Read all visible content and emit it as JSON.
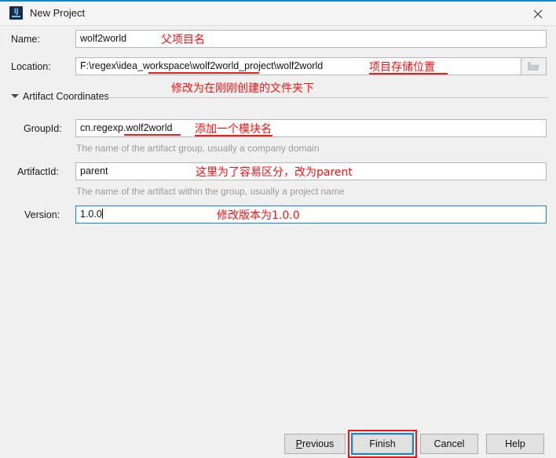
{
  "window": {
    "title": "New Project",
    "app_icon": "intellij-idea-icon",
    "close_icon": "close-icon",
    "accent_color": "#1587c4"
  },
  "form": {
    "name": {
      "label": "Name:",
      "value": "wolf2world"
    },
    "location": {
      "label": "Location:",
      "value": "F:\\regex\\idea_workspace\\wolf2world_project\\wolf2world",
      "browse_icon": "folder-open-icon"
    },
    "section": {
      "title": "Artifact Coordinates",
      "expand_icon": "chevron-down-icon",
      "expanded": true
    },
    "group_id": {
      "label": "GroupId:",
      "value": "cn.regexp.wolf2world",
      "helper": "The name of the artifact group, usually a company domain"
    },
    "artifact_id": {
      "label": "ArtifactId:",
      "value": "parent",
      "helper": "The name of the artifact within the group, usually a project name"
    },
    "version": {
      "label": "Version:",
      "value": "1.0.0",
      "focused": true
    }
  },
  "annotations": {
    "color": "#fa0f0f",
    "name_note": "父项目名",
    "location_note": "项目存储位置",
    "location_sub_note": "修改为在刚刚创建的文件夹下",
    "group_id_note": "添加一个模块名",
    "artifact_id_note": "这里为了容易区分，改为parent",
    "version_note": "修改版本为1.0.0",
    "highlight_target": "finish-button"
  },
  "buttons": {
    "previous": {
      "label": "Previous",
      "mnemonic": "P"
    },
    "finish": {
      "label": "Finish",
      "mnemonic": "F",
      "focused": true
    },
    "cancel": {
      "label": "Cancel"
    },
    "help": {
      "label": "Help"
    }
  }
}
